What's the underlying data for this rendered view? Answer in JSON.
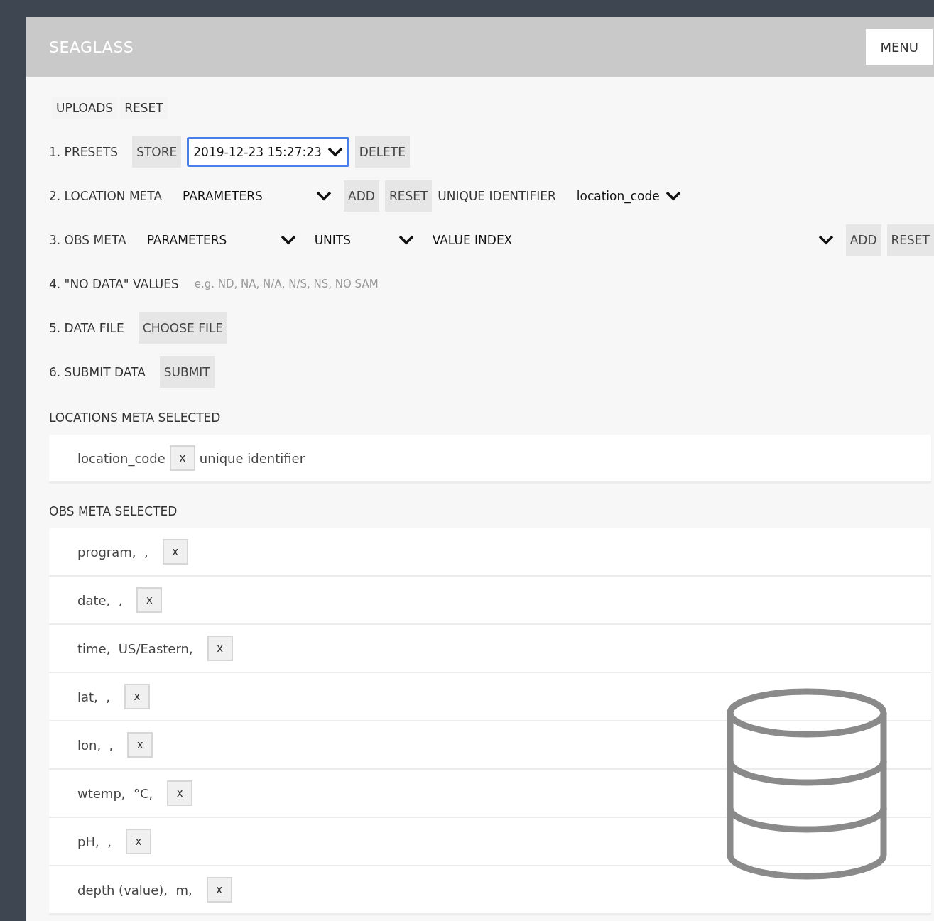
{
  "header": {
    "title": "SEAGLASS",
    "menu_button": "MENU"
  },
  "toolbar": [
    {
      "label": "UPLOADS"
    },
    {
      "label": "RESET"
    }
  ],
  "steps": [
    {
      "parts": [
        {
          "kind": "label",
          "text": "1. PRESETS"
        },
        {
          "kind": "button",
          "text": "STORE"
        },
        {
          "kind": "select",
          "text": "2019-12-23 15:27:23",
          "focused": true
        },
        {
          "kind": "button",
          "text": "DELETE"
        }
      ]
    },
    {
      "parts": [
        {
          "kind": "label",
          "text": "2. LOCATION META"
        },
        {
          "kind": "select-wide",
          "text": "PARAMETERS",
          "focused": false
        },
        {
          "kind": "button",
          "text": "ADD"
        },
        {
          "kind": "button",
          "text": "RESET"
        },
        {
          "kind": "label",
          "text": "UNIQUE IDENTIFIER"
        },
        {
          "kind": "select",
          "text": "location_code",
          "focused": false
        }
      ]
    },
    {
      "parts": [
        {
          "kind": "label",
          "text": "3. OBS META"
        },
        {
          "kind": "select-wide",
          "text": "PARAMETERS",
          "focused": false
        },
        {
          "kind": "select-mid",
          "text": "UNITS",
          "focused": false
        },
        {
          "kind": "select-grow",
          "text": "VALUE INDEX",
          "focused": false
        },
        {
          "kind": "button",
          "text": "ADD"
        },
        {
          "kind": "button",
          "text": "RESET"
        }
      ]
    },
    {
      "parts": [
        {
          "kind": "label",
          "text": "4. \"NO DATA\" VALUES"
        },
        {
          "kind": "input",
          "placeholder": "e.g. ND, NA, N/A, N/S, NS, NO SAM"
        }
      ]
    },
    {
      "parts": [
        {
          "kind": "label",
          "text": "5. DATA FILE"
        },
        {
          "kind": "button",
          "text": "CHOOSE FILE"
        }
      ]
    },
    {
      "parts": [
        {
          "kind": "label",
          "text": "6. SUBMIT DATA"
        },
        {
          "kind": "button",
          "text": "SUBMIT"
        }
      ]
    }
  ],
  "locations_meta": {
    "heading": "LOCATIONS META SELECTED",
    "items": [
      {
        "name": "location_code",
        "remove": "x",
        "note": "unique identifier"
      }
    ]
  },
  "obs_meta": {
    "heading": "OBS META SELECTED",
    "items": [
      {
        "name": "program,  ,",
        "remove": "x"
      },
      {
        "name": "date,  ,",
        "remove": "x"
      },
      {
        "name": "time,  US/Eastern,",
        "remove": "x"
      },
      {
        "name": "lat,  ,",
        "remove": "x"
      },
      {
        "name": "lon,  ,",
        "remove": "x"
      },
      {
        "name": "wtemp,  °C,",
        "remove": "x"
      },
      {
        "name": "pH,  ,",
        "remove": "x"
      },
      {
        "name": "depth (value),  m,",
        "remove": "x"
      }
    ]
  }
}
